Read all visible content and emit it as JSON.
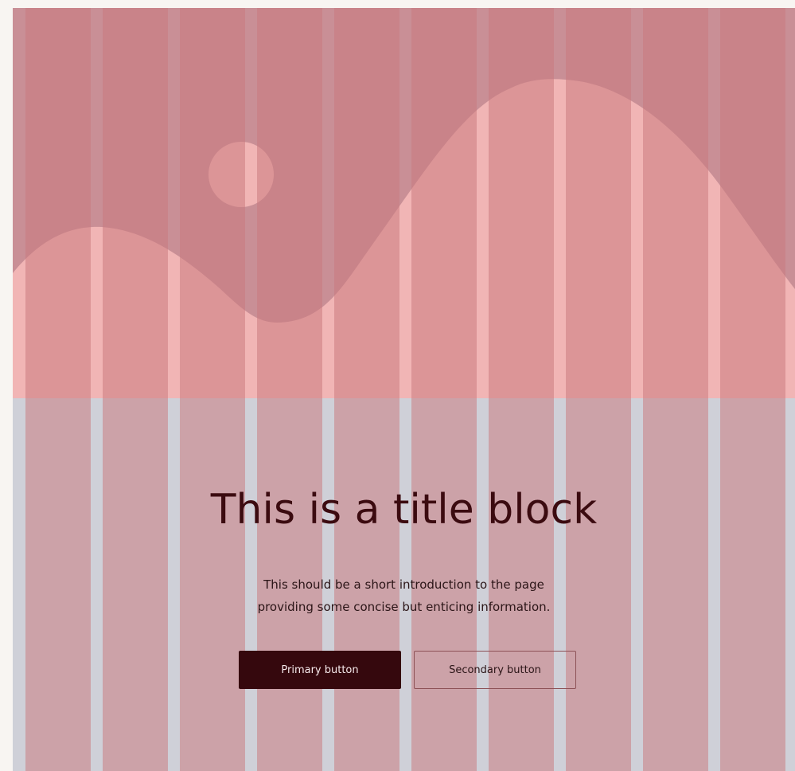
{
  "hero": {
    "title": "This is a title block",
    "intro_line_1": "This should be a short introduction to the page",
    "intro_line_2": "providing some concise but enticing information."
  },
  "actions": {
    "primary_label": "Primary button",
    "secondary_label": "Secondary button"
  },
  "colors": {
    "page_background": "#f8f5f2",
    "grid_column": "#c9787d",
    "illustration_sky": "#c98f96",
    "illustration_hill": "#f1b5b5",
    "title_text": "#3b0b10",
    "primary_button": "#35080d"
  },
  "icons": {
    "illustration": "landscape-illustration",
    "sun": "sun-circle"
  }
}
